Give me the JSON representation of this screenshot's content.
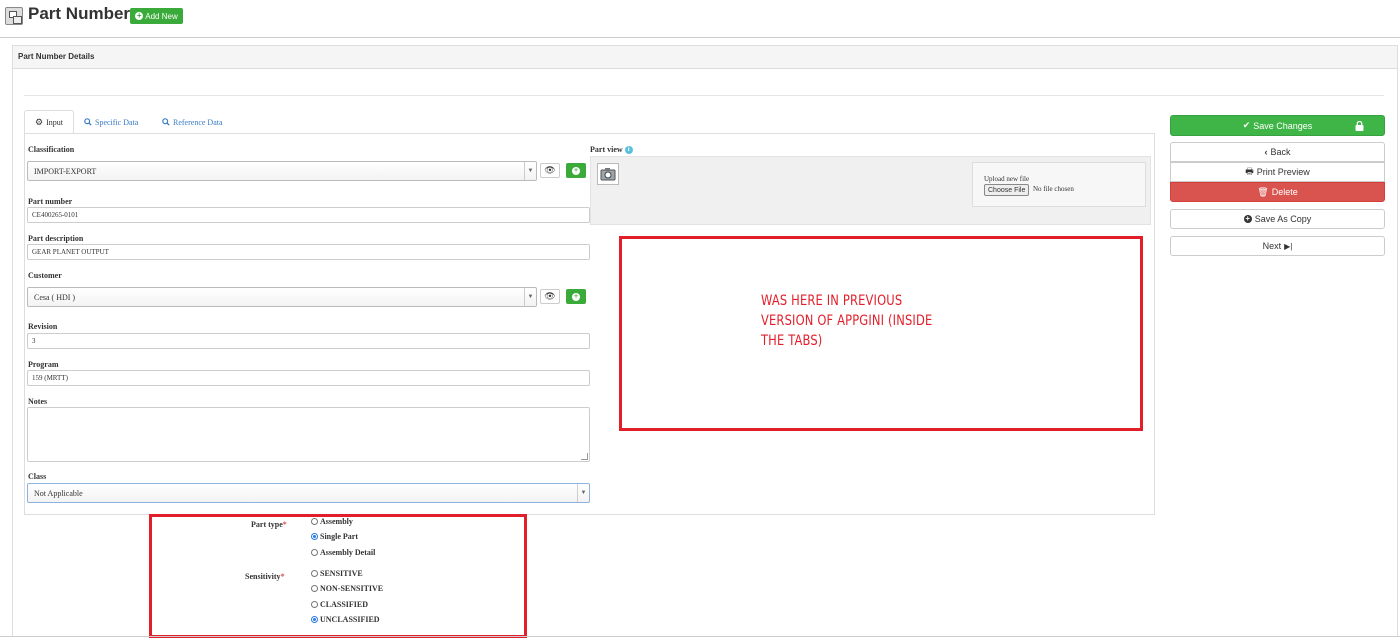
{
  "header": {
    "title": "Part Number",
    "add_new_label": "Add New"
  },
  "panel": {
    "title": "Part Number Details"
  },
  "tabs": [
    {
      "label": "Input",
      "icon": "gear-icon",
      "active": true
    },
    {
      "label": "Specific Data",
      "icon": "search-icon",
      "active": false
    },
    {
      "label": "Reference Data",
      "icon": "search-icon",
      "active": false
    }
  ],
  "form": {
    "classification": {
      "label": "Classification",
      "value": "IMPORT-EXPORT"
    },
    "part_number": {
      "label": "Part number",
      "value": "CE400265-0101"
    },
    "part_description": {
      "label": "Part description",
      "value": "GEAR PLANET OUTPUT"
    },
    "customer": {
      "label": "Customer",
      "value": "Cesa ( HDI )"
    },
    "revision": {
      "label": "Revision",
      "value": "3"
    },
    "program": {
      "label": "Program",
      "value": "159 (MRTT)"
    },
    "notes": {
      "label": "Notes",
      "value": ""
    },
    "class": {
      "label": "Class",
      "value": "Not Applicable"
    }
  },
  "part_view": {
    "label": "Part view",
    "upload_label": "Upload new file",
    "choose_file_label": "Choose File",
    "no_file_text": "No file chosen"
  },
  "annotation": {
    "lines": [
      "WAS HERE IN PREVIOUS",
      "VERSION OF APPGINI (INSIDE",
      "THE TABS)"
    ],
    "color": "#e11f2a"
  },
  "actions": {
    "save_changes": "Save Changes",
    "print_preview": "Print Preview",
    "back": "Back",
    "delete": "Delete",
    "save_as_copy": "Save As Copy",
    "next": "Next"
  },
  "part_type": {
    "label": "Part type",
    "required_mark": "*",
    "options": [
      {
        "label": "Assembly",
        "checked": false
      },
      {
        "label": "Single Part",
        "checked": true
      },
      {
        "label": "Assembly Detail",
        "checked": false
      }
    ]
  },
  "sensitivity": {
    "label": "Sensitivity",
    "required_mark": "*",
    "options": [
      {
        "label": "SENSITIVE",
        "checked": false
      },
      {
        "label": "NON-SENSITIVE",
        "checked": false
      },
      {
        "label": "CLASSIFIED",
        "checked": false
      },
      {
        "label": "UNCLASSIFIED",
        "checked": true
      }
    ]
  },
  "colors": {
    "success": "#3fb548",
    "danger": "#d9534f",
    "link": "#3a7bc8",
    "annotation": "#e11f2a"
  }
}
